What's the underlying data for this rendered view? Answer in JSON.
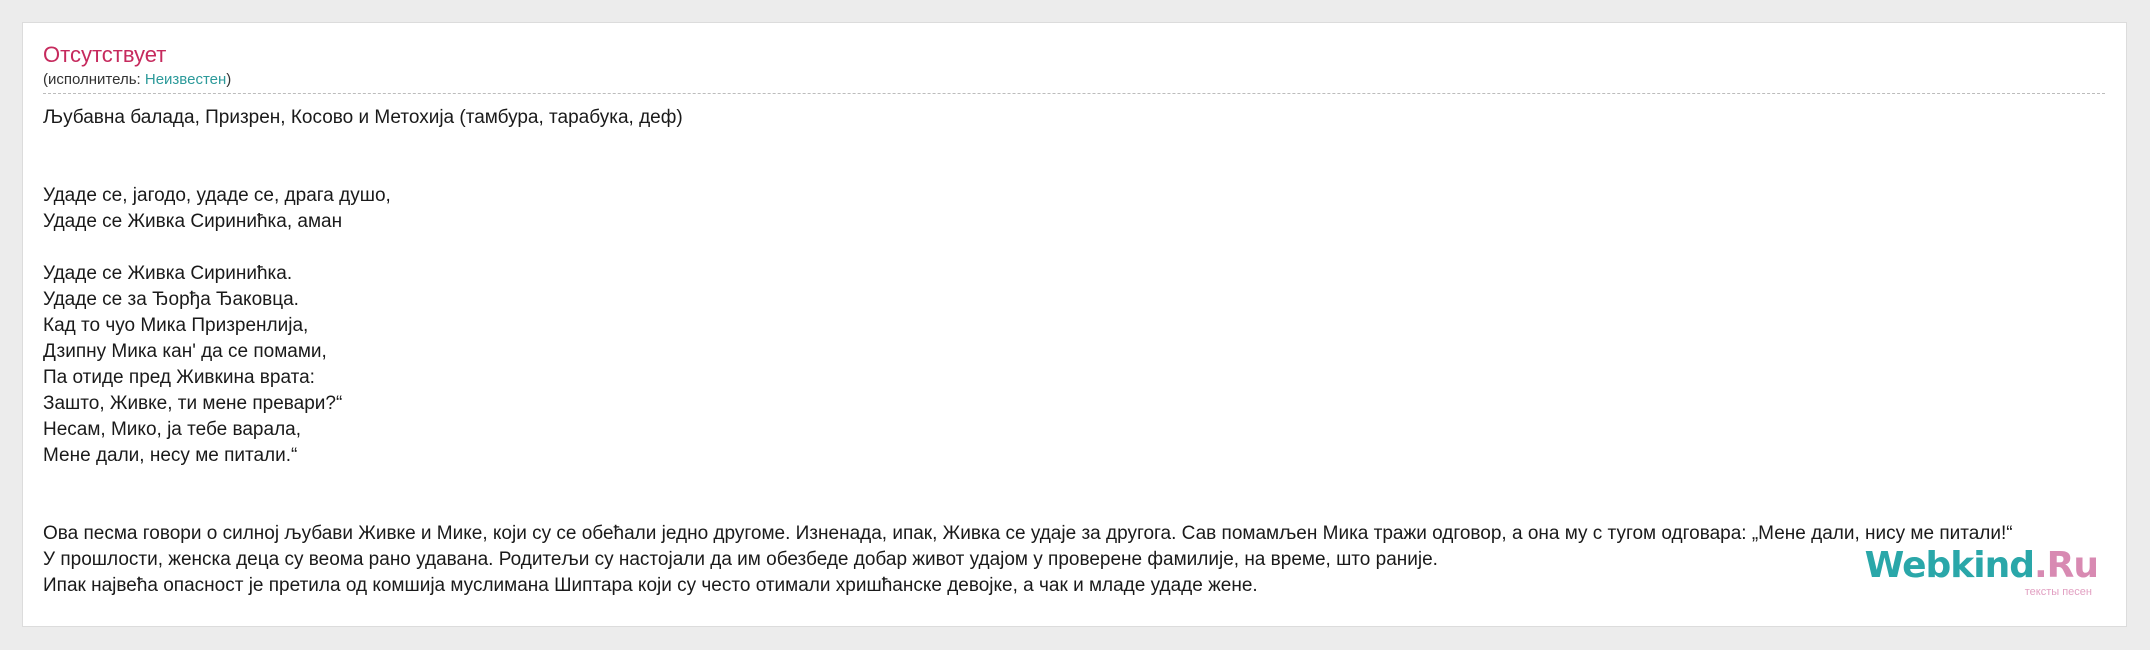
{
  "song": {
    "title": "Отсутствует",
    "performer_prefix": "(исполнитель: ",
    "performer_name": "Неизвестен",
    "performer_suffix": ")"
  },
  "subtitle": "Љубавна балада, Призрен, Косово и Метохија (тамбура, тарабука, деф)",
  "lyrics": {
    "stanza1": [
      "Удаде се, јагодо, удаде се, драга душо,",
      "Удаде се Живка Сириниħка, аман"
    ],
    "stanza2": [
      "Удаде се Живка Сириниħка.",
      "Удаде се за Ђорђа Ђаковца.",
      "Кад то чуо Мика Призренлија,",
      "Дзипну Мика кан' да се помами,",
      "Па отиде пред Живкина врата:",
      "Зашто, Живке, ти мене превари?“",
      "Несам, Мико, ја тебе варала,",
      "Мене дали, несу ме питали.“"
    ]
  },
  "notes": [
    "Ова песма говори о силној љубави Живке и Мике, који су се обећали једно другоме. Изненада, ипак, Живка се удаје за другога. Сав помамљен Мика тражи одговор, а она му с тугом одговара: „Мене дали, нису ме питали!“",
    "У прошлости, женска деца су веома рано удавана. Родитељи су настојали да им обезбеде добар живот удајом у проверене фамилије, на време, што раније.",
    "Ипак највећа опасност је претила од комшија муслимана Шиптара који су често отимали хришћанске девојке, а чак и младе удаде жене."
  ],
  "logo": {
    "main": "Webkind",
    "suffix": ".Ru",
    "tagline": "тексты песен"
  },
  "colors": {
    "title": "#c62a5d",
    "link": "#2c9a9a",
    "logo": "#2aa7a9",
    "logo_suffix": "#d88ab2"
  }
}
